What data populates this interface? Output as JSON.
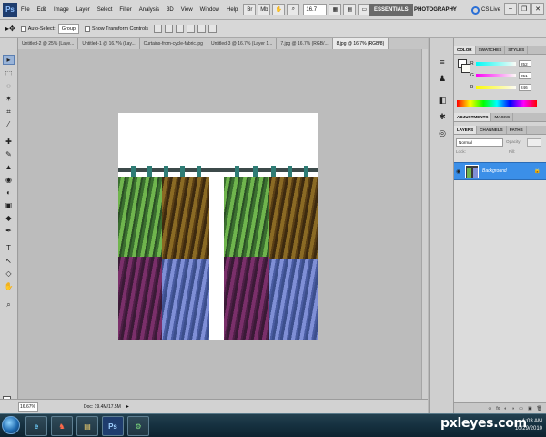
{
  "menubar": {
    "logo": "Ps",
    "items": [
      "File",
      "Edit",
      "Image",
      "Layer",
      "Select",
      "Filter",
      "Analysis",
      "3D",
      "View",
      "Window",
      "Help"
    ],
    "zoom": "16.7",
    "workspace_active": "ESSENTIALS",
    "workspace_other": "PHOTOGRAPHY",
    "more": "»",
    "cs_live": "CS Live"
  },
  "options": {
    "auto_select_label": "Auto-Select:",
    "auto_select_value": "Group",
    "show_transform_label": "Show Transform Controls"
  },
  "doc_tabs": [
    "Untitled-2 @ 25% (Laye...",
    "Untitled-1 @ 16.7% (Lay...",
    "Curtains-from-cycle-fabric.jpg",
    "Untitled-3 @ 16.7% (Layer 1...",
    "7.jpg @ 16.7% (RGB/...",
    "8.jpg @ 16.7% (RGB/8)"
  ],
  "active_tab_index": 5,
  "tools": [
    "▸",
    "⬚",
    "◌",
    "✶",
    "⌗",
    "⁄",
    "✚",
    "✎",
    "▲",
    "◉",
    "◐",
    "▣",
    "◆",
    "✒",
    "T",
    "↖",
    "◇",
    "✋",
    "⌕"
  ],
  "status": {
    "zoom": "16.67%",
    "doc": "Doc: 19.4M/17.5M",
    "arrow": "▸"
  },
  "panel_icons": [
    "≡",
    "♟",
    "◧",
    "✱",
    "◎"
  ],
  "color_panel": {
    "tabs": [
      "COLOR",
      "SWATCHES",
      "STYLES"
    ],
    "r_label": "R",
    "r_value": "252",
    "g_label": "G",
    "g_value": "251",
    "b_label": "B",
    "b_value": "246"
  },
  "adjust_tabs": [
    "ADJUSTMENTS",
    "MASKS"
  ],
  "layers_panel": {
    "tabs": [
      "LAYERS",
      "CHANNELS",
      "PATHS"
    ],
    "blend_mode": "Normal",
    "opacity_label": "Opacity:",
    "lock_label": "Lock:",
    "fill_label": "Fill:",
    "layer_name": "Background",
    "footer_icons": [
      "∞",
      "fx",
      "◐",
      "◑",
      "▭",
      "▣",
      "🗑"
    ]
  },
  "taskbar": {
    "apps": [
      "e",
      "♞",
      "▤",
      "Ps",
      "⚙"
    ],
    "time": "1:03 AM",
    "date": "10/29/2010"
  },
  "watermark": "pxleyes.com",
  "colors": {
    "accent_selection": "#3b8fe8",
    "curtain_green": "#6fb54d",
    "curtain_brown": "#8a6a24",
    "curtain_purple": "#7a2f6a",
    "curtain_blue": "#7f8fd6"
  }
}
